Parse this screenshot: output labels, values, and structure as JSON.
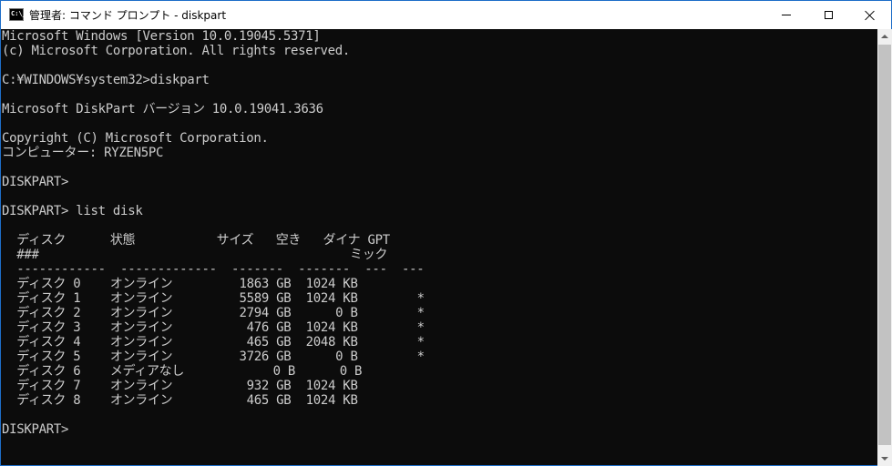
{
  "window": {
    "title": "管理者: コマンド プロンプト - diskpart",
    "icon_label": "C:\\_"
  },
  "controls": {
    "minimize": "minimize-icon",
    "maximize": "maximize-icon",
    "close": "close-icon"
  },
  "console": {
    "lines": [
      "Microsoft Windows [Version 10.0.19045.5371]",
      "(c) Microsoft Corporation. All rights reserved.",
      "",
      "C:¥WINDOWS¥system32>diskpart",
      "",
      "Microsoft DiskPart バージョン 10.0.19041.3636",
      "",
      "Copyright (C) Microsoft Corporation.",
      "コンピューター: RYZEN5PC",
      "",
      "DISKPART>",
      "",
      "DISKPART> list disk",
      "",
      "  ディスク      状態           サイズ   空き   ダイナ GPT",
      "  ###                                          ミック",
      "  ------------  -------------  -------  -------  ---  ---",
      "  ディスク 0    オンライン         1863 GB  1024 KB",
      "  ディスク 1    オンライン         5589 GB  1024 KB        *",
      "  ディスク 2    オンライン         2794 GB      0 B        *",
      "  ディスク 3    オンライン          476 GB  1024 KB        *",
      "  ディスク 4    オンライン          465 GB  2048 KB        *",
      "  ディスク 5    オンライン         3726 GB      0 B        *",
      "  ディスク 6    メディアなし            0 B      0 B",
      "  ディスク 7    オンライン          932 GB  1024 KB",
      "  ディスク 8    オンライン          465 GB  1024 KB",
      "",
      "DISKPART> "
    ]
  },
  "colors": {
    "console_bg": "#0c0c0c",
    "console_fg": "#cccccc",
    "titlebar_bg": "#ffffff",
    "window_border": "#1e6ec8"
  }
}
